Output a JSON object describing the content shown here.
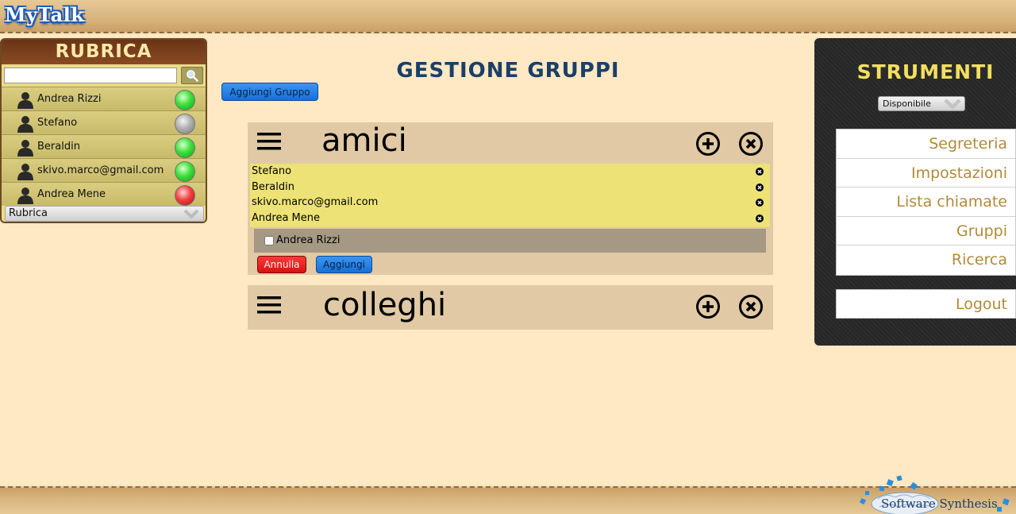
{
  "app": {
    "logo": "MyTalk"
  },
  "rubrica": {
    "title": "RUBRICA",
    "search_placeholder": "",
    "contacts": [
      {
        "name": "Andrea Rizzi",
        "status": "online"
      },
      {
        "name": "Stefano",
        "status": "offline"
      },
      {
        "name": "Beraldin",
        "status": "online"
      },
      {
        "name": "skivo.marco@gmail.com",
        "status": "online"
      },
      {
        "name": "Andrea Mene",
        "status": "busy"
      }
    ],
    "selected_list": "Rubrica"
  },
  "main": {
    "title": "GESTIONE GRUPPI",
    "add_group_label": "Aggiungi Gruppo",
    "groups": [
      {
        "name": "amici",
        "members": [
          "Stefano",
          "Beraldin",
          "skivo.marco@gmail.com",
          "Andrea Mene"
        ],
        "candidates": [
          "Andrea Rizzi"
        ],
        "cancel_label": "Annulla",
        "add_label": "Aggiungi"
      },
      {
        "name": "colleghi"
      }
    ]
  },
  "strumenti": {
    "title": "STRUMENTI",
    "status_value": "Disponibile",
    "menu": [
      "Segreteria",
      "Impostazioni",
      "Lista chiamate",
      "Gruppi",
      "Ricerca"
    ],
    "logout": "Logout"
  },
  "footer": {
    "brand": "Software Synthesis"
  },
  "colors": {
    "background": "#ffe8c4",
    "title": "#1b3f66",
    "strumenti_title": "#f2df5e",
    "menu_text": "#b08a3a",
    "members_bg": "#ede275",
    "group_bg": "#e0c9a4"
  }
}
